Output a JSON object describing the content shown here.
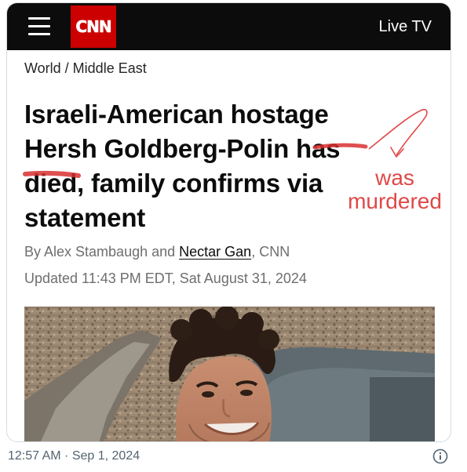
{
  "header": {
    "menu_icon": "hamburger-menu-icon",
    "logo_text": "CNN",
    "live_tv": "Live TV"
  },
  "article": {
    "breadcrumb": "World / Middle East",
    "headline_before": "Israeli-American hostage Hersh Goldberg-Polin ",
    "struck_word_1": "has",
    "struck_word_2": "died",
    "headline_after": ", family confirms via statement",
    "byline_prefix": "By Alex Stambaugh and ",
    "byline_link": "Nectar Gan",
    "byline_suffix": ", CNN",
    "updated": "Updated 11:43 PM EDT, Sat August 31, 2024",
    "photo_alt": "photo of a smiling young man with curly dark hair"
  },
  "annotation": {
    "text_line1": "was",
    "text_line2": "murdered",
    "color": "#e04848"
  },
  "tweet": {
    "timestamp": "12:57 AM · Sep 1, 2024",
    "info_icon": "info-icon"
  }
}
